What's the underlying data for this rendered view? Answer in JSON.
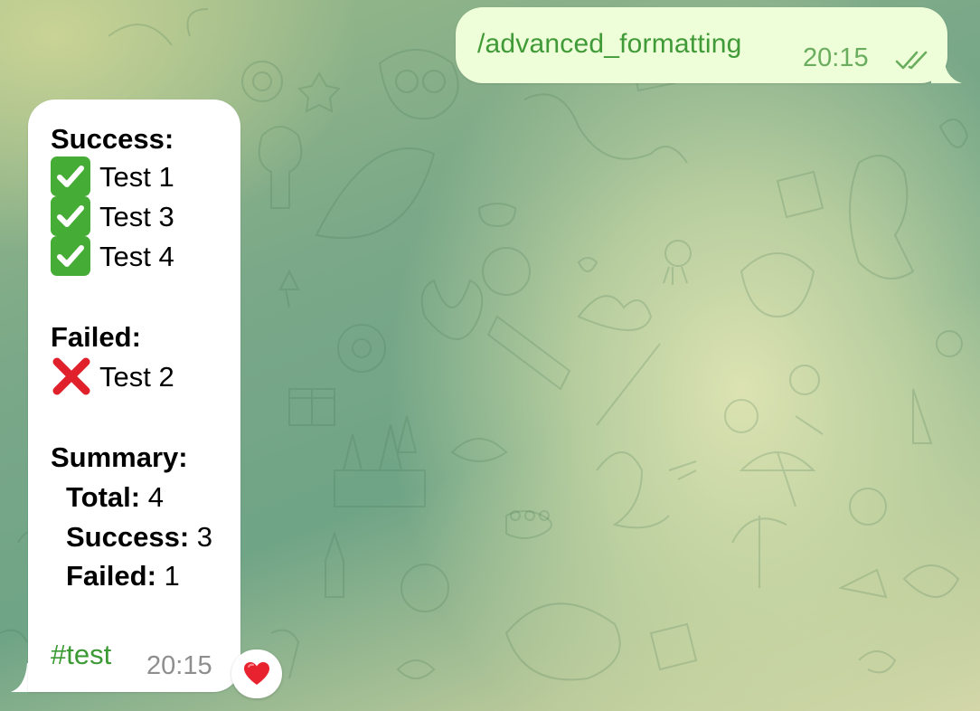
{
  "outgoing_message": {
    "text": "/advanced_formatting",
    "time": "20:15",
    "status_icon": "double-check-icon"
  },
  "incoming_message": {
    "success_heading": "Success:",
    "success_items": [
      "Test 1",
      "Test 3",
      "Test 4"
    ],
    "success_icon": "green-check-emoji",
    "failed_heading": "Failed:",
    "failed_items": [
      "Test 2"
    ],
    "failed_icon": "red-cross-emoji",
    "summary_heading": "Summary:",
    "summary": [
      {
        "label": "Total:",
        "value": "4"
      },
      {
        "label": "Success:",
        "value": "3"
      },
      {
        "label": "Failed:",
        "value": "1"
      }
    ],
    "hashtag": "#test",
    "time": "20:15",
    "reaction": "❤️"
  },
  "colors": {
    "outgoing_bubble": "#eefed8",
    "outgoing_text": "#3f9a37",
    "incoming_bubble": "#ffffff",
    "hashtag": "#3c9a35",
    "check_bg": "#45ad36",
    "cross": "#e0202a"
  }
}
